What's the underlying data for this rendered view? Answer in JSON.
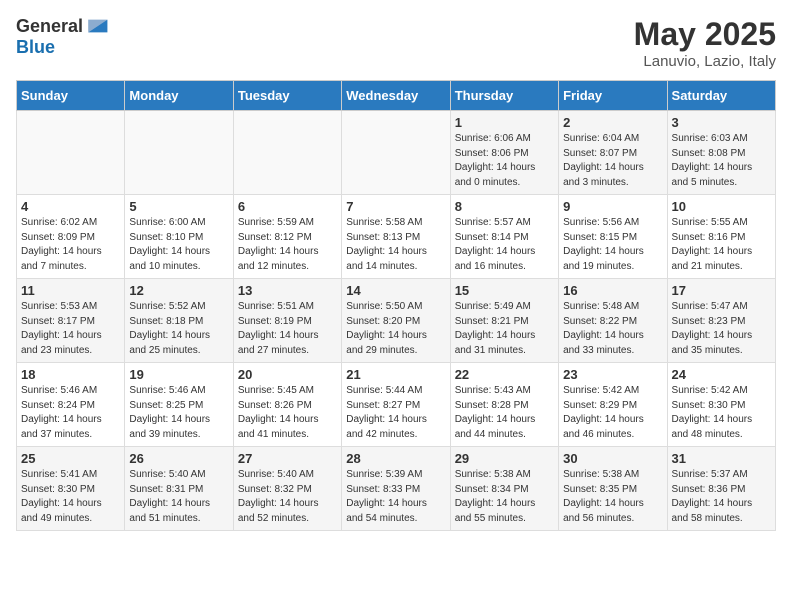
{
  "logo": {
    "general": "General",
    "blue": "Blue"
  },
  "title": "May 2025",
  "subtitle": "Lanuvio, Lazio, Italy",
  "days_header": [
    "Sunday",
    "Monday",
    "Tuesday",
    "Wednesday",
    "Thursday",
    "Friday",
    "Saturday"
  ],
  "weeks": [
    [
      {
        "day": "",
        "info": ""
      },
      {
        "day": "",
        "info": ""
      },
      {
        "day": "",
        "info": ""
      },
      {
        "day": "",
        "info": ""
      },
      {
        "day": "1",
        "info": "Sunrise: 6:06 AM\nSunset: 8:06 PM\nDaylight: 14 hours and 0 minutes."
      },
      {
        "day": "2",
        "info": "Sunrise: 6:04 AM\nSunset: 8:07 PM\nDaylight: 14 hours and 3 minutes."
      },
      {
        "day": "3",
        "info": "Sunrise: 6:03 AM\nSunset: 8:08 PM\nDaylight: 14 hours and 5 minutes."
      }
    ],
    [
      {
        "day": "4",
        "info": "Sunrise: 6:02 AM\nSunset: 8:09 PM\nDaylight: 14 hours and 7 minutes."
      },
      {
        "day": "5",
        "info": "Sunrise: 6:00 AM\nSunset: 8:10 PM\nDaylight: 14 hours and 10 minutes."
      },
      {
        "day": "6",
        "info": "Sunrise: 5:59 AM\nSunset: 8:12 PM\nDaylight: 14 hours and 12 minutes."
      },
      {
        "day": "7",
        "info": "Sunrise: 5:58 AM\nSunset: 8:13 PM\nDaylight: 14 hours and 14 minutes."
      },
      {
        "day": "8",
        "info": "Sunrise: 5:57 AM\nSunset: 8:14 PM\nDaylight: 14 hours and 16 minutes."
      },
      {
        "day": "9",
        "info": "Sunrise: 5:56 AM\nSunset: 8:15 PM\nDaylight: 14 hours and 19 minutes."
      },
      {
        "day": "10",
        "info": "Sunrise: 5:55 AM\nSunset: 8:16 PM\nDaylight: 14 hours and 21 minutes."
      }
    ],
    [
      {
        "day": "11",
        "info": "Sunrise: 5:53 AM\nSunset: 8:17 PM\nDaylight: 14 hours and 23 minutes."
      },
      {
        "day": "12",
        "info": "Sunrise: 5:52 AM\nSunset: 8:18 PM\nDaylight: 14 hours and 25 minutes."
      },
      {
        "day": "13",
        "info": "Sunrise: 5:51 AM\nSunset: 8:19 PM\nDaylight: 14 hours and 27 minutes."
      },
      {
        "day": "14",
        "info": "Sunrise: 5:50 AM\nSunset: 8:20 PM\nDaylight: 14 hours and 29 minutes."
      },
      {
        "day": "15",
        "info": "Sunrise: 5:49 AM\nSunset: 8:21 PM\nDaylight: 14 hours and 31 minutes."
      },
      {
        "day": "16",
        "info": "Sunrise: 5:48 AM\nSunset: 8:22 PM\nDaylight: 14 hours and 33 minutes."
      },
      {
        "day": "17",
        "info": "Sunrise: 5:47 AM\nSunset: 8:23 PM\nDaylight: 14 hours and 35 minutes."
      }
    ],
    [
      {
        "day": "18",
        "info": "Sunrise: 5:46 AM\nSunset: 8:24 PM\nDaylight: 14 hours and 37 minutes."
      },
      {
        "day": "19",
        "info": "Sunrise: 5:46 AM\nSunset: 8:25 PM\nDaylight: 14 hours and 39 minutes."
      },
      {
        "day": "20",
        "info": "Sunrise: 5:45 AM\nSunset: 8:26 PM\nDaylight: 14 hours and 41 minutes."
      },
      {
        "day": "21",
        "info": "Sunrise: 5:44 AM\nSunset: 8:27 PM\nDaylight: 14 hours and 42 minutes."
      },
      {
        "day": "22",
        "info": "Sunrise: 5:43 AM\nSunset: 8:28 PM\nDaylight: 14 hours and 44 minutes."
      },
      {
        "day": "23",
        "info": "Sunrise: 5:42 AM\nSunset: 8:29 PM\nDaylight: 14 hours and 46 minutes."
      },
      {
        "day": "24",
        "info": "Sunrise: 5:42 AM\nSunset: 8:30 PM\nDaylight: 14 hours and 48 minutes."
      }
    ],
    [
      {
        "day": "25",
        "info": "Sunrise: 5:41 AM\nSunset: 8:30 PM\nDaylight: 14 hours and 49 minutes."
      },
      {
        "day": "26",
        "info": "Sunrise: 5:40 AM\nSunset: 8:31 PM\nDaylight: 14 hours and 51 minutes."
      },
      {
        "day": "27",
        "info": "Sunrise: 5:40 AM\nSunset: 8:32 PM\nDaylight: 14 hours and 52 minutes."
      },
      {
        "day": "28",
        "info": "Sunrise: 5:39 AM\nSunset: 8:33 PM\nDaylight: 14 hours and 54 minutes."
      },
      {
        "day": "29",
        "info": "Sunrise: 5:38 AM\nSunset: 8:34 PM\nDaylight: 14 hours and 55 minutes."
      },
      {
        "day": "30",
        "info": "Sunrise: 5:38 AM\nSunset: 8:35 PM\nDaylight: 14 hours and 56 minutes."
      },
      {
        "day": "31",
        "info": "Sunrise: 5:37 AM\nSunset: 8:36 PM\nDaylight: 14 hours and 58 minutes."
      }
    ]
  ]
}
